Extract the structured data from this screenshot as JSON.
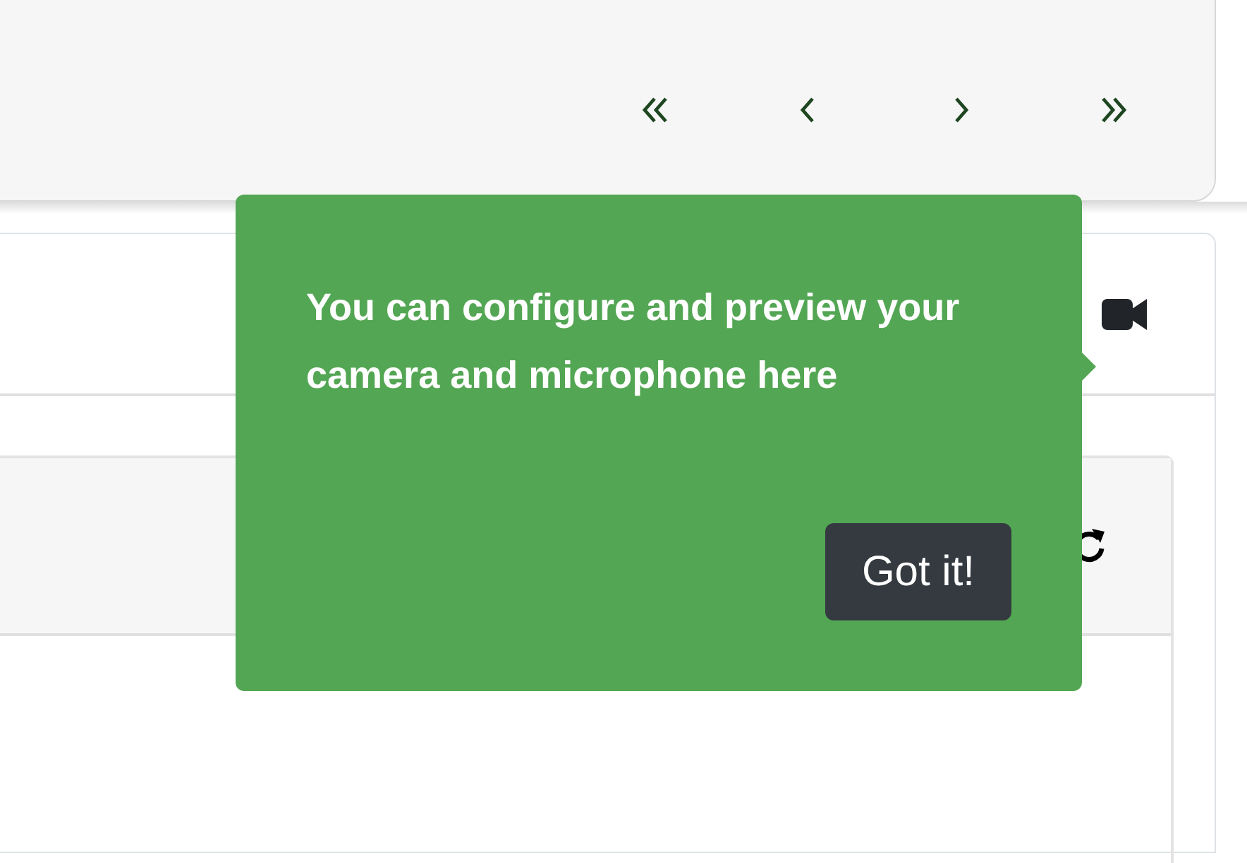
{
  "tour_popover": {
    "text": "You can configure and preview your camera and microphone here",
    "button": "Got it!"
  }
}
